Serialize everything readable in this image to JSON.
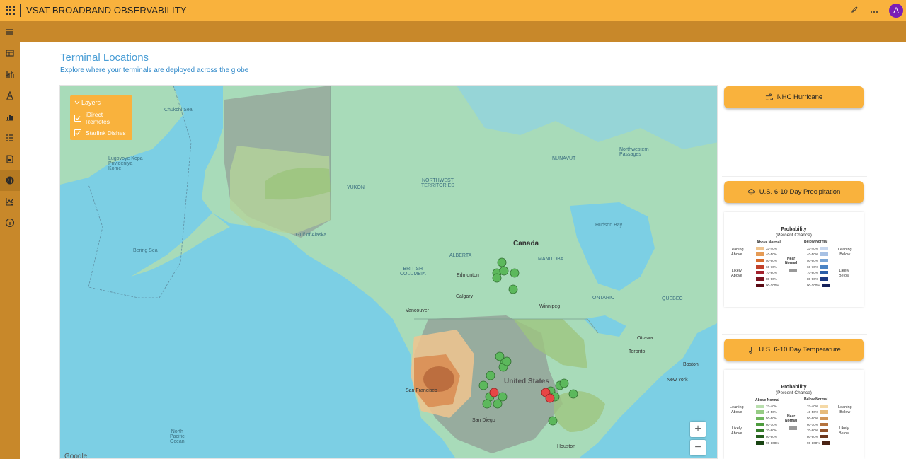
{
  "topbar": {
    "app_title": "VSAT BROADBAND OBSERVABILITY",
    "avatar_initial": "A",
    "edit_icon": "pencil-icon",
    "more_icon": "ellipsis-icon"
  },
  "nav": {
    "items": [
      "menu-icon",
      "dashboard-icon",
      "chart-icon",
      "text-icon",
      "bar-chart-icon",
      "list-icon",
      "report-icon",
      "globe-icon",
      "analytics-icon",
      "info-icon"
    ],
    "active": "globe-icon"
  },
  "page": {
    "title": "Terminal Locations",
    "subtitle": "Explore where your terminals are deployed across the globe"
  },
  "map": {
    "layers": {
      "header": "Layers",
      "items": [
        {
          "label": "iDirect Remotes",
          "checked": true
        },
        {
          "label": "Starlink Dishes",
          "checked": true
        }
      ]
    },
    "labels": {
      "canada": "Canada",
      "united_states": "United States",
      "chukchi_sea": "Chukchi Sea",
      "bering_sea": "Bering Sea",
      "gulf_of_alaska": "Gulf of Alaska",
      "hudson_bay": "Hudson Bay",
      "north_pacific": "North\nPacific\nOcean",
      "northwest_passages": "Northwestern\nPassages",
      "nunavut": "NUNAVUT",
      "yukon": "YUKON",
      "nw_territories": "NORTHWEST\nTERRITORIES",
      "alberta": "ALBERTA",
      "manitoba": "MANITOBA",
      "british_columbia": "BRITISH\nCOLUMBIA",
      "ontario": "ONTARIO",
      "quebec": "QUEBEC",
      "lugovoye": "Lugovoye Kopa\nPrivideniya\nKome",
      "edmonton": "Edmonton",
      "calgary": "Calgary",
      "vancouver": "Vancouver",
      "winnipeg": "Winnipeg",
      "ottawa": "Ottawa",
      "toronto": "Toronto",
      "boston": "Boston",
      "new_york": "New York",
      "san_francisco": "San Francisco",
      "san_diego": "San Diego",
      "houston": "Houston"
    },
    "zoom_in": "+",
    "zoom_out": "−",
    "attribution": "Google",
    "marker_colors": {
      "idirect": "#5cb85c",
      "starlink": "#e84545"
    }
  },
  "panel": {
    "buttons": [
      {
        "label": "NHC Hurricane",
        "icon": "wind-icon"
      },
      {
        "label": "U.S. 6-10 Day Precipitation",
        "icon": "cloud-rain-icon"
      },
      {
        "label": "U.S. 6-10 Day Temperature",
        "icon": "thermometer-icon"
      }
    ],
    "precip_legend": {
      "title": "Probability",
      "subtitle": "(Percent Chance)",
      "above_header": "Above Normal",
      "below_header": "Below Normal",
      "near": "Near\nNormal",
      "leaning_above": "Leaning\nAbove",
      "likely_above": "Likely\nAbove",
      "leaning_below": "Leaning\nBelow",
      "likely_below": "Likely\nBelow",
      "ranges": [
        "33-40%",
        "40-50%",
        "50-60%",
        "60-70%",
        "70-80%",
        "80-90%",
        "90-100%"
      ],
      "above_colors": [
        "#f0c48e",
        "#e59b55",
        "#d86c2e",
        "#c2412a",
        "#a3212c",
        "#7d1420",
        "#5a0b14"
      ],
      "below_colors": [
        "#c7d7ee",
        "#a7c1e4",
        "#7aa6d6",
        "#4a84c5",
        "#2b5ea8",
        "#1d3a84",
        "#15205a"
      ]
    },
    "temp_legend": {
      "title": "Probability",
      "subtitle": "(Percent Chance)",
      "above_header": "Above Normal",
      "below_header": "Below Normal",
      "near": "Near\nNormal",
      "leaning_above": "Leaning\nAbove",
      "likely_above": "Likely\nAbove",
      "leaning_below": "Leaning\nBelow",
      "likely_below": "Likely\nBelow",
      "ranges": [
        "33-40%",
        "40-50%",
        "50-60%",
        "60-70%",
        "70-80%",
        "80-90%",
        "90-100%"
      ],
      "above_colors": [
        "#b9dfae",
        "#96cc84",
        "#6fb65d",
        "#4e9c3e",
        "#357d2a",
        "#245e1c",
        "#184412"
      ],
      "below_colors": [
        "#f5d9a6",
        "#e6bb7c",
        "#d19658",
        "#b5733e",
        "#92522b",
        "#6d371e",
        "#4a2314"
      ]
    }
  }
}
